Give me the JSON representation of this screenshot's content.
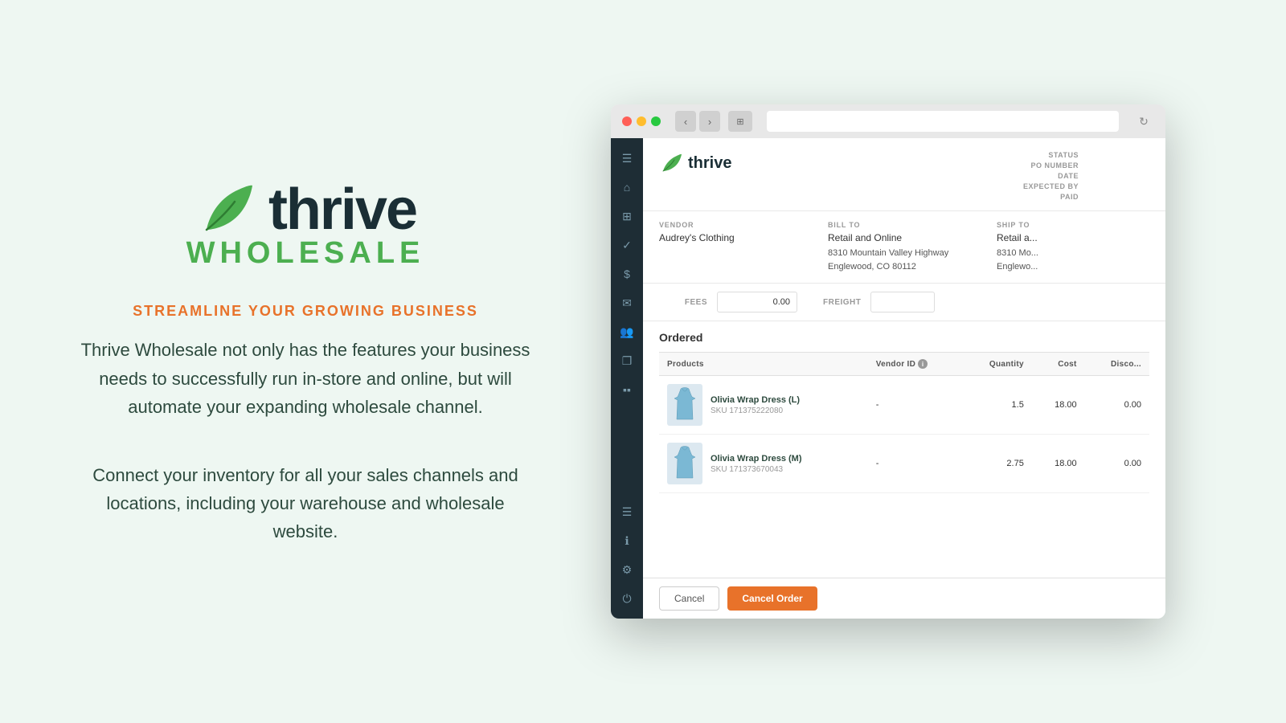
{
  "left": {
    "tagline": "STREAMLINE YOUR GROWING BUSINESS",
    "description1": "Thrive Wholesale not only has the features your business needs to successfully run in-store and online, but will automate your expanding wholesale channel.",
    "description2": "Connect your inventory for all your sales channels and locations, including your warehouse and wholesale website.",
    "logo_thrive": "thrive",
    "logo_wholesale": "WHOLESALE"
  },
  "browser": {
    "url_placeholder": ""
  },
  "app": {
    "logo_name": "thrive",
    "po_meta": {
      "status_label": "STATUS",
      "status_value": "",
      "po_number_label": "PO NUMBER",
      "po_number_value": "",
      "date_label": "DATE",
      "date_value": "",
      "expected_by_label": "EXPECTED BY",
      "expected_by_value": "",
      "paid_label": "PAID",
      "paid_value": ""
    },
    "vendor": {
      "label": "VENDOR",
      "name": "Audrey's Clothing"
    },
    "bill_to": {
      "label": "BILL TO",
      "name": "Retail and Online",
      "address1": "8310 Mountain Valley Highway",
      "address2": "Englewood, CO 80112"
    },
    "ship_to": {
      "label": "SHIP TO",
      "name": "Retail a...",
      "address1": "8310 Mo...",
      "address2": "Englewo..."
    },
    "fees": {
      "label": "FEES",
      "value": "0.00"
    },
    "freight": {
      "label": "FREIGHT",
      "value": ""
    },
    "ordered_title": "Ordered",
    "table": {
      "headers": {
        "products": "Products",
        "vendor_id": "Vendor ID",
        "quantity": "Quantity",
        "cost": "Cost",
        "discount": "Disco..."
      },
      "rows": [
        {
          "name": "Olivia Wrap Dress (L)",
          "sku": "SKU 171375222080",
          "vendor_id": "-",
          "quantity": "1.5",
          "cost": "18.00",
          "discount": "0.00"
        },
        {
          "name": "Olivia Wrap Dress (M)",
          "sku": "SKU 171373670043",
          "vendor_id": "-",
          "quantity": "2.75",
          "cost": "18.00",
          "discount": "0.00"
        }
      ]
    },
    "buttons": {
      "cancel": "Cancel",
      "cancel_order": "Cancel Order"
    }
  },
  "sidebar": {
    "icons": [
      {
        "name": "menu-icon",
        "glyph": "☰"
      },
      {
        "name": "home-icon",
        "glyph": "⌂"
      },
      {
        "name": "grid-icon",
        "glyph": "⊞"
      },
      {
        "name": "check-icon",
        "glyph": "✓"
      },
      {
        "name": "dollar-icon",
        "glyph": "$"
      },
      {
        "name": "mail-icon",
        "glyph": "✉"
      },
      {
        "name": "users-icon",
        "glyph": "👥"
      },
      {
        "name": "copy-icon",
        "glyph": "❐"
      },
      {
        "name": "chart-icon",
        "glyph": "📊"
      },
      {
        "name": "list-icon",
        "glyph": "☰"
      },
      {
        "name": "info-icon",
        "glyph": "ℹ"
      },
      {
        "name": "settings-icon",
        "glyph": "⚙"
      },
      {
        "name": "power-icon",
        "glyph": "⏻"
      }
    ]
  },
  "colors": {
    "background": "#eef7f2",
    "sidebar_bg": "#1e2d35",
    "green": "#4caf50",
    "orange": "#e8722a",
    "dark_text": "#1a2e35"
  }
}
